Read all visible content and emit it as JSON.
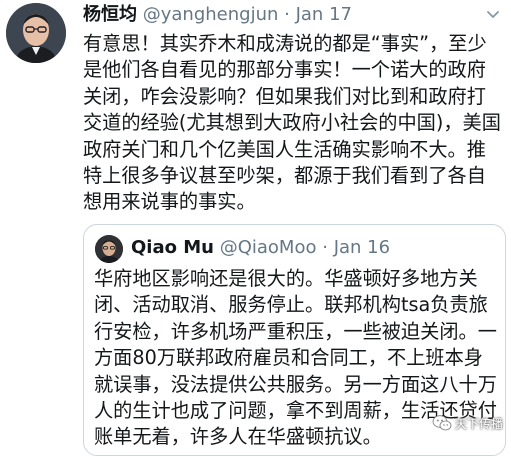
{
  "tweet": {
    "author_name": "杨恒均",
    "author_handle": "@yanghengjun",
    "separator": "·",
    "date": "Jan 17",
    "text": "有意思！其实乔木和成涛说的都是“事实”，至少是他们各自看见的那部分事实！一个诺大的政府关闭，咋会没影响？但如果我们对比到和政府打交道的经验(尤其想到大政府小社会的中国)，美国政府关门和几个亿美国人生活确实影响不大。推特上很多争议甚至吵架，都源于我们看到了各自想用来说事的事实。",
    "icons": {
      "avatar": "avatar-icon",
      "more": "chevron-down-icon"
    }
  },
  "quoted": {
    "author_name": "Qiao Mu",
    "author_handle": "@QiaoMoo",
    "separator": "·",
    "date": "Jan 16",
    "text": "华府地区影响还是很大的。华盛顿好多地方关闭、活动取消、服务停止。联邦机构tsa负责旅行安检，许多机场严重积压，一些被迫关闭。一方面80万联邦政府雇员和合同工，不上班本身就误事，没法提供公共服务。另一方面这八十万人的生计也成了问题，拿不到周薪，生活还贷付账单无着，许多人在华盛顿抗议。"
  },
  "watermark": {
    "text": "天下传播",
    "icon": "wechat-icon"
  },
  "colors": {
    "text": "#14171a",
    "secondary": "#657786",
    "border": "#ccd6dd"
  }
}
